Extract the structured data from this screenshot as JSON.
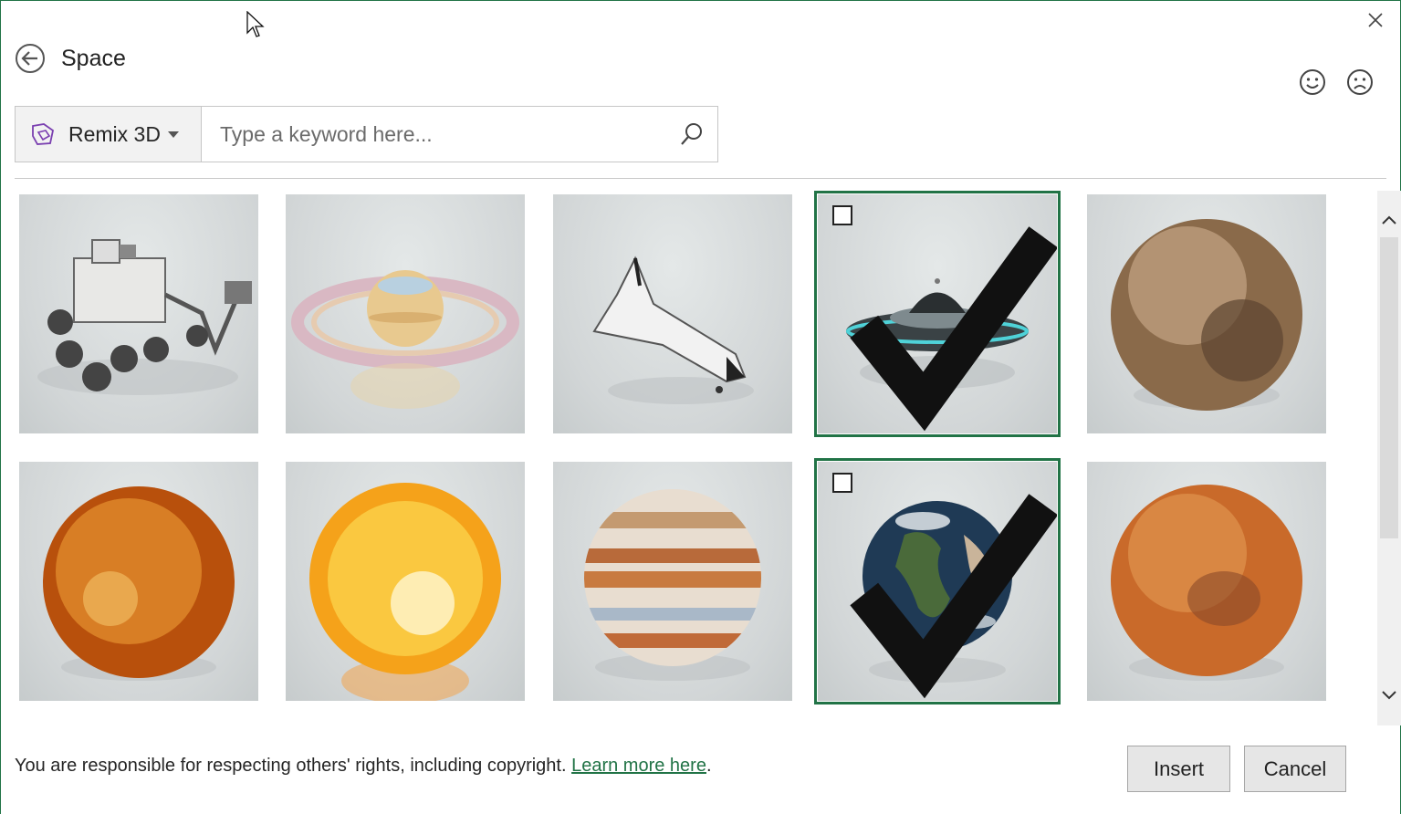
{
  "dialog": {
    "title": "Space",
    "close_icon": "close-icon",
    "back_icon": "back-arrow-icon",
    "feedback": [
      "smile-icon",
      "frown-icon"
    ]
  },
  "search": {
    "source_label": "Remix 3D",
    "source_icon": "remix-3d-icon",
    "placeholder": "Type a keyword here...",
    "value": ""
  },
  "results": [
    {
      "name": "rover",
      "selected": false
    },
    {
      "name": "ringed-planet",
      "selected": false
    },
    {
      "name": "space-shuttle",
      "selected": false
    },
    {
      "name": "ufo",
      "selected": true
    },
    {
      "name": "pluto",
      "selected": false
    },
    {
      "name": "venus",
      "selected": false
    },
    {
      "name": "sun",
      "selected": false
    },
    {
      "name": "jupiter",
      "selected": false
    },
    {
      "name": "earth",
      "selected": true
    },
    {
      "name": "mars",
      "selected": false
    }
  ],
  "footer": {
    "note": "You are responsible for respecting others' rights, including copyright.",
    "link": "Learn more here",
    "period": "."
  },
  "buttons": {
    "insert": "Insert",
    "cancel": "Cancel"
  },
  "colors": {
    "accent": "#217346",
    "brand_icon": "#7a3fb0"
  }
}
